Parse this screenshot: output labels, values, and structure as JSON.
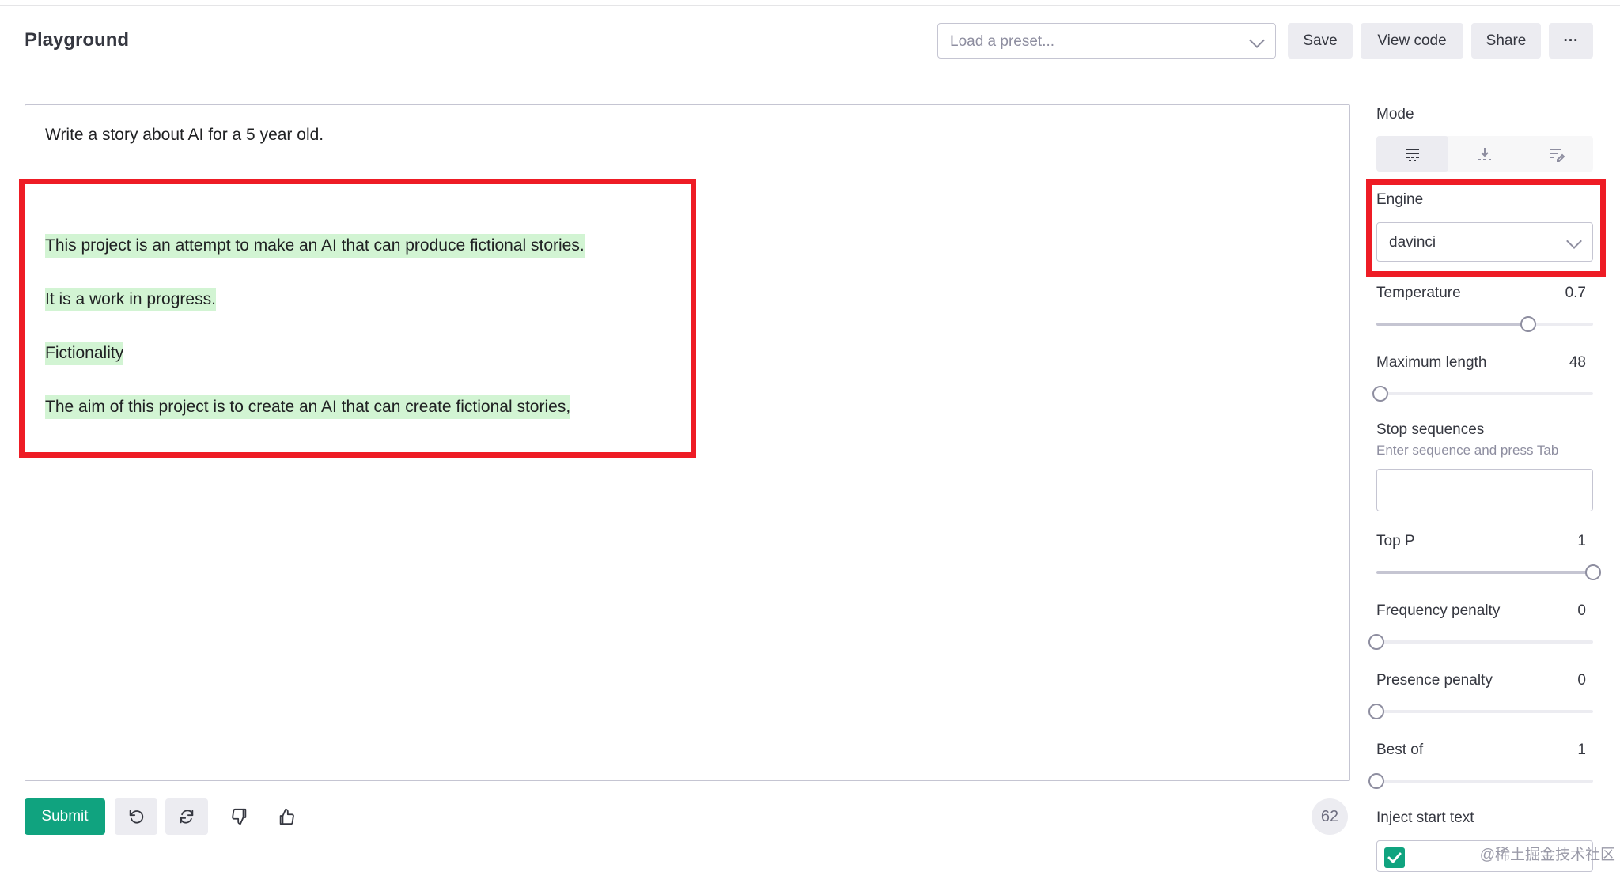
{
  "header": {
    "title": "Playground",
    "preset_placeholder": "Load a preset...",
    "save_label": "Save",
    "view_code_label": "View code",
    "share_label": "Share",
    "more_label": "···"
  },
  "editor": {
    "prompt": "Write a story about AI for a 5 year old.",
    "generated": [
      "This project is an attempt to make an AI that can produce fictional stories.",
      "It is a work in progress.",
      "Fictionality",
      "The aim of this project is to create an AI that can create fictional stories,"
    ],
    "highlight_color": "#d2f4d3"
  },
  "toolbar": {
    "submit_label": "Submit",
    "token_count": "62",
    "icons": [
      "undo-icon",
      "regenerate-icon",
      "thumbs-down-icon",
      "thumbs-up-icon"
    ]
  },
  "sidebar": {
    "mode_label": "Mode",
    "mode_options": [
      "complete-icon",
      "insert-icon",
      "edit-icon"
    ],
    "engine_label": "Engine",
    "engine_value": "davinci",
    "temperature": {
      "label": "Temperature",
      "value": "0.7",
      "fraction": 0.7
    },
    "max_length": {
      "label": "Maximum length",
      "value": "48",
      "fraction": 0.02
    },
    "stop_sequences": {
      "label": "Stop sequences",
      "help": "Enter sequence and press Tab"
    },
    "top_p": {
      "label": "Top P",
      "value": "1",
      "fraction": 1.0
    },
    "frequency_penalty": {
      "label": "Frequency penalty",
      "value": "0",
      "fraction": 0.0
    },
    "presence_penalty": {
      "label": "Presence penalty",
      "value": "0",
      "fraction": 0.0
    },
    "best_of": {
      "label": "Best of",
      "value": "1",
      "fraction": 0.0
    },
    "inject_start_text": {
      "label": "Inject start text"
    }
  },
  "watermark": "@稀土掘金技术社区",
  "colors": {
    "accent": "#10a37f",
    "annotation_red": "#ee1c25"
  }
}
